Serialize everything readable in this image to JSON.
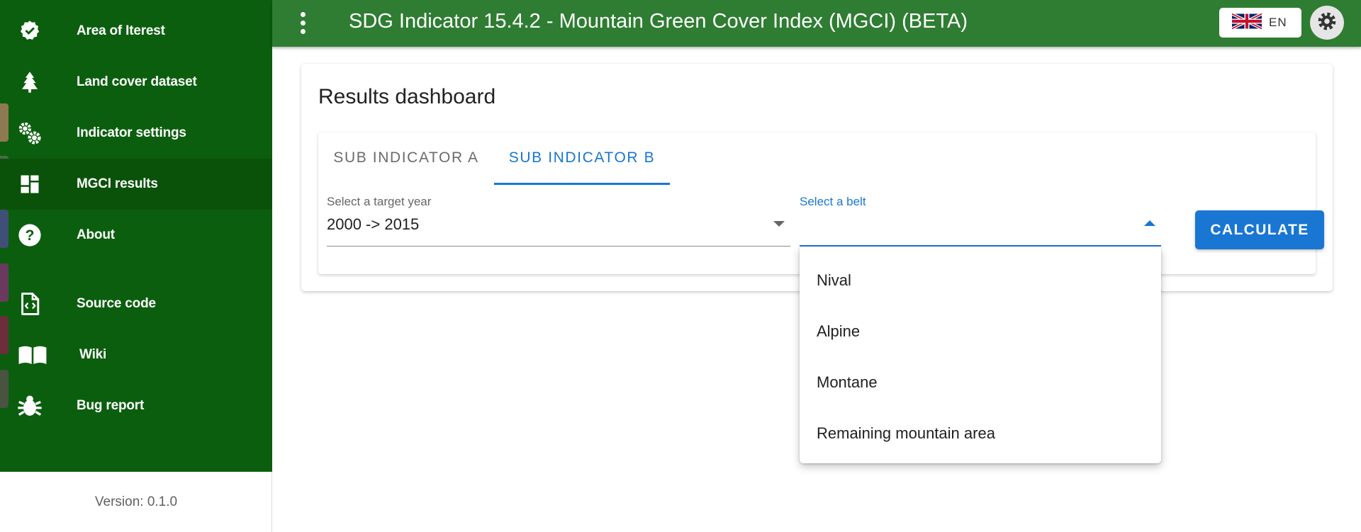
{
  "sidebar": {
    "items": [
      {
        "label": "Area of Iterest",
        "icon": "verified-check-icon"
      },
      {
        "label": "Land cover dataset",
        "icon": "tree-icon"
      },
      {
        "label": "Indicator settings",
        "icon": "gears-icon"
      },
      {
        "label": "MGCI results",
        "icon": "dashboard-icon"
      },
      {
        "label": "About",
        "icon": "help-circle-icon"
      },
      {
        "label": "Source code",
        "icon": "code-file-icon"
      },
      {
        "label": "Wiki",
        "icon": "book-icon"
      },
      {
        "label": "Bug report",
        "icon": "bug-icon"
      }
    ],
    "version": "Version: 0.1.0"
  },
  "header": {
    "title": "SDG Indicator 15.4.2 - Mountain Green Cover Index (MGCI) (BETA)",
    "language": "EN"
  },
  "main": {
    "title": "Results dashboard",
    "tabs": [
      {
        "label": "SUB INDICATOR A"
      },
      {
        "label": "SUB INDICATOR B"
      }
    ],
    "year_select": {
      "label": "Select a target year",
      "value": "2000 -> 2015"
    },
    "belt_select": {
      "label": "Select a belt",
      "value": ""
    },
    "calculate_label": "CALCULATE",
    "belt_options": [
      "Nival",
      "Alpine",
      "Montane",
      "Remaining mountain area"
    ]
  },
  "colors": {
    "sidebar_green": "#0b5e0e",
    "topbar_green": "#2e7d32",
    "accent_blue": "#1976d2"
  }
}
